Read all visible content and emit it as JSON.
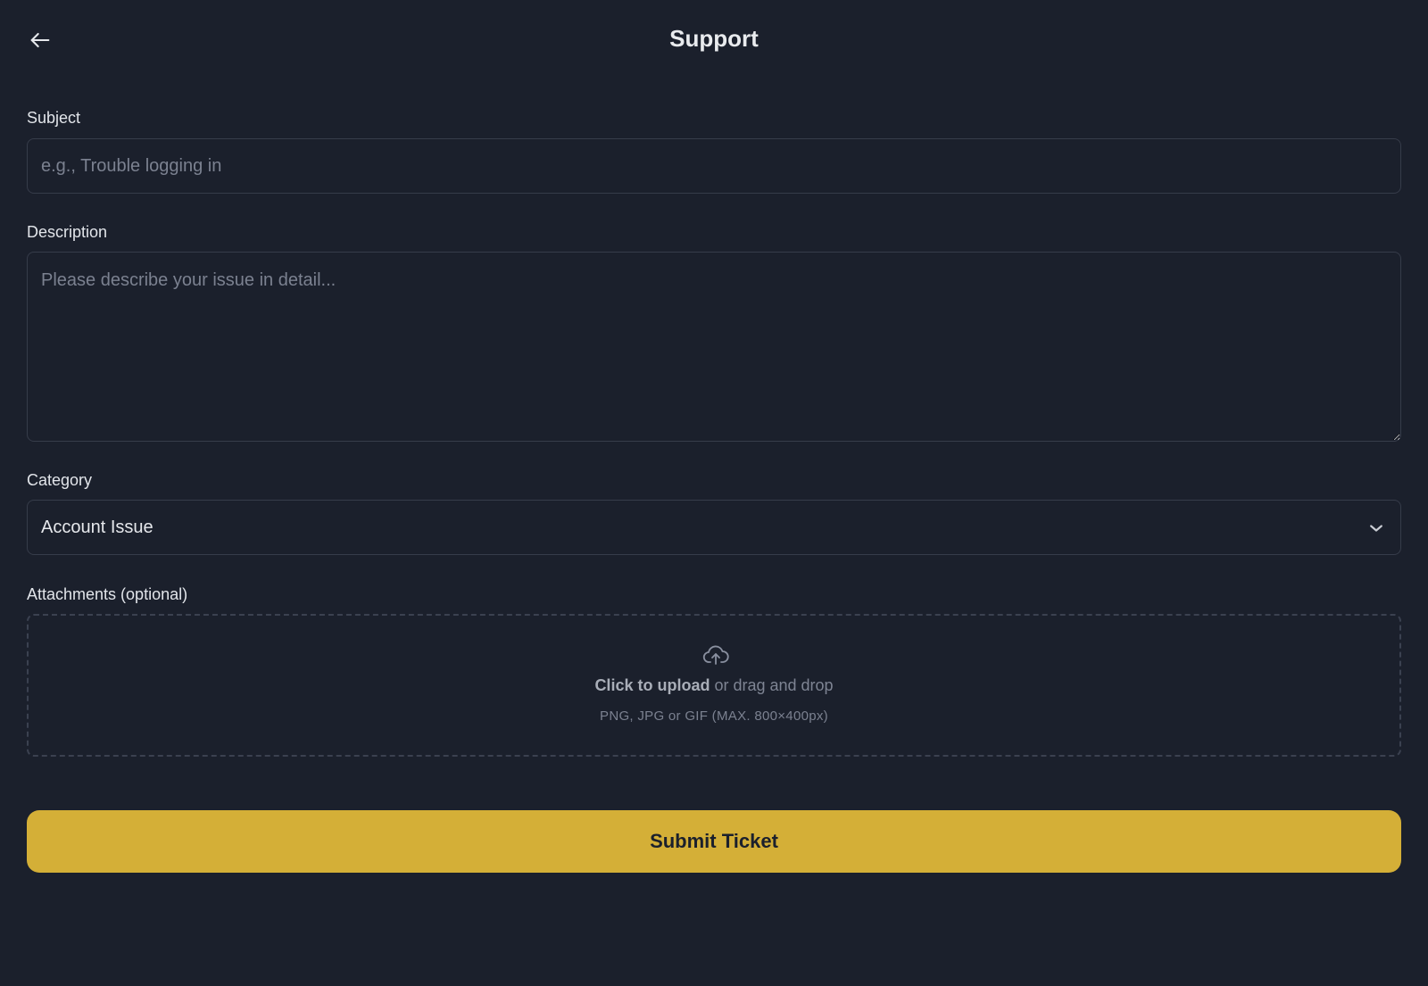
{
  "header": {
    "title": "Support",
    "back_icon": "arrow-left-icon"
  },
  "form": {
    "subject": {
      "label": "Subject",
      "placeholder": "e.g., Trouble logging in",
      "value": ""
    },
    "description": {
      "label": "Description",
      "placeholder": "Please describe your issue in detail...",
      "value": ""
    },
    "category": {
      "label": "Category",
      "selected": "Account Issue",
      "icon": "chevron-down-icon"
    },
    "attachments": {
      "label": "Attachments (optional)",
      "icon": "cloud-upload-icon",
      "cta_strong": "Click to upload",
      "cta_rest": " or drag and drop",
      "hint": "PNG, JPG or GIF (MAX. 800×400px)"
    },
    "submit_label": "Submit Ticket"
  },
  "colors": {
    "background": "#1b202c",
    "accent": "#d4af37",
    "border": "#363c4a",
    "placeholder": "#7b8190"
  }
}
